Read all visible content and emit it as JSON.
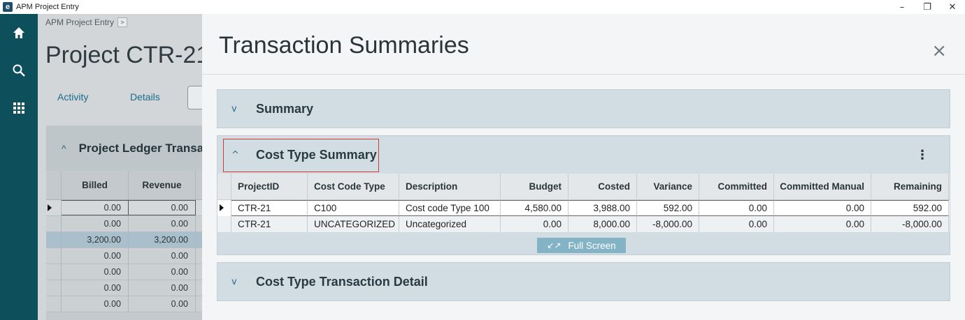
{
  "window": {
    "title": "APM Project Entry",
    "logo_letter": "e",
    "minimize": "–",
    "restore": "❐",
    "close": "✕"
  },
  "rail": {
    "items": [
      {
        "icon": "home-icon"
      },
      {
        "icon": "search-icon"
      },
      {
        "icon": "apps-grid-icon"
      }
    ]
  },
  "background": {
    "breadcrumb": "APM Project Entry",
    "breadcrumb_arrow": ">",
    "project_title": "Project CTR-21",
    "tabs": [
      "Activity",
      "Details"
    ],
    "ledger": {
      "chevron": "^",
      "title": "Project Ledger Transactions",
      "columns": [
        "Billed",
        "Revenue"
      ],
      "rows": [
        [
          "0.00",
          "0.00"
        ],
        [
          "0.00",
          "0.00"
        ],
        [
          "3,200.00",
          "3,200.00"
        ],
        [
          "0.00",
          "0.00"
        ],
        [
          "0.00",
          "0.00"
        ],
        [
          "0.00",
          "0.00"
        ],
        [
          "0.00",
          "0.00"
        ]
      ]
    }
  },
  "panel": {
    "title": "Transaction Summaries",
    "close": "×",
    "sections": {
      "summary": {
        "title": "Summary",
        "chevron": "v"
      },
      "cost_type": {
        "title": "Cost Type Summary",
        "chevron": "^",
        "menu": "⋮",
        "columns": [
          "ProjectID",
          "Cost Code Type",
          "Description",
          "Budget",
          "Costed",
          "Variance",
          "Committed",
          "Committed Manual",
          "Remaining"
        ],
        "rows": [
          [
            "CTR-21",
            "C100",
            "Cost code Type 100",
            "4,580.00",
            "3,988.00",
            "592.00",
            "0.00",
            "0.00",
            "592.00"
          ],
          [
            "CTR-21",
            "UNCATEGORIZED",
            "Uncategorized",
            "0.00",
            "8,000.00",
            "-8,000.00",
            "0.00",
            "0.00",
            "-8,000.00"
          ]
        ],
        "fullscreen_label": "Full Screen",
        "fullscreen_icon": "↙↗"
      },
      "detail": {
        "title": "Cost Type Transaction Detail",
        "chevron": "v"
      }
    }
  }
}
